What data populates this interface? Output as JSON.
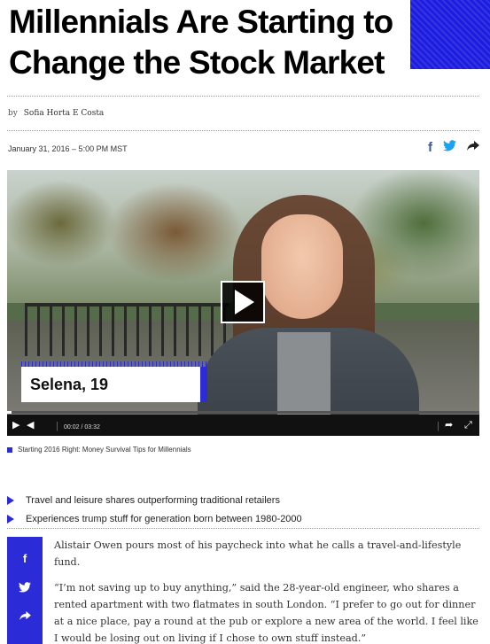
{
  "article": {
    "title_line1": "Millennials Are Starting to",
    "title_line2": "Change the Stock Market",
    "byline_prefix": "by",
    "author": "Sofia Horta E Costa",
    "date": "January 31, 2016 – 5:00 PM MST",
    "bullets": [
      "Travel and leisure shares outperforming traditional retailers",
      "Experiences trump stuff for generation born between 1980-2000"
    ],
    "paragraphs": [
      "Alistair Owen pours most of his paycheck into what he calls a travel-and-lifestyle fund.",
      "“I’m not saving up to buy anything,” said the 28-year-old engineer, who shares a rented apartment with two flatmates in south London. “I prefer to go out for dinner at a nice place, pay a round at the pub or explore a new area of the world. I feel like I would be losing out on living if I chose to own stuff instead.”"
    ]
  },
  "share_icons": {
    "facebook": "f",
    "twitter": "❖",
    "share": "➦"
  },
  "video": {
    "lower_third_name": "Selena, 19",
    "time_display": "00:02 / 03:32",
    "progress_fraction": 0.01,
    "caption": "Starting 2016 Right: Money Survival Tips for Millennials",
    "icons": {
      "play": "▶",
      "volume": "◀",
      "share": "➦",
      "fullscreen": "⤢"
    }
  },
  "colors": {
    "accent": "#2b2bd8",
    "facebook": "#3b5998",
    "twitter": "#1da1f2"
  }
}
